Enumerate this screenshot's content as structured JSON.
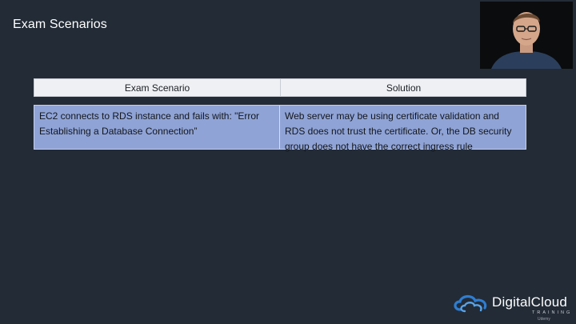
{
  "slide": {
    "title": "Exam Scenarios"
  },
  "table": {
    "headers": [
      "Exam Scenario",
      "Solution"
    ],
    "rows": [
      {
        "scenario": "EC2 connects to RDS instance and fails with: \"Error Establishing a Database Connection”",
        "solution": "Web server may be using certificate validation and RDS does not trust the certificate. Or, the DB security group does not have the correct ingress rule"
      }
    ]
  },
  "branding": {
    "logo_text": "DigitalCloud",
    "logo_subtext": "TRAINING",
    "watermark": "Udemy",
    "accent_color": "#2e7dd1"
  },
  "colors": {
    "background": "#232b36",
    "header_bg": "#eef0f4",
    "row_bg": "#8fa3d6"
  }
}
